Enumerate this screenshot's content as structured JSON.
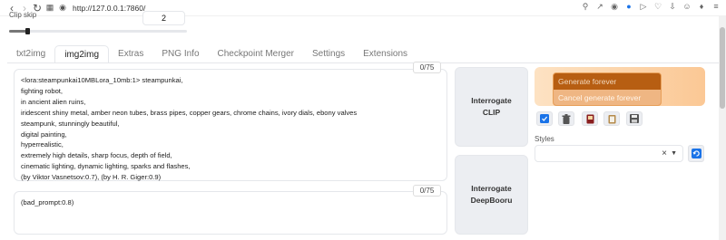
{
  "browser": {
    "url": "http://127.0.0.1:7860/"
  },
  "clip_skip": {
    "label": "Clip skip",
    "value": "2",
    "level": 0.1
  },
  "tabs": [
    {
      "label": "txt2img",
      "active": false
    },
    {
      "label": "img2img",
      "active": true
    },
    {
      "label": "Extras",
      "active": false
    },
    {
      "label": "PNG Info",
      "active": false
    },
    {
      "label": "Checkpoint Merger",
      "active": false
    },
    {
      "label": "Settings",
      "active": false
    },
    {
      "label": "Extensions",
      "active": false
    }
  ],
  "prompt": {
    "counter": "0/75",
    "text": "<lora:steampunkai10MBLora_10mb:1> steampunkai,\nfighting robot,\nin ancient alien ruins,\niridescent shiny metal, amber neon tubes, brass pipes, copper gears, chrome chains, ivory dials, ebony valves\nsteampunk, stunningly beautiful,\ndigital painting,\nhyperrealistic,\nextremely high details, sharp focus, depth of field,\ncinematic lighting, dynamic lighting, sparks and flashes,\n(by Viktor Vasnetsov:0.7), (by H. R. Giger:0.9)"
  },
  "negative_prompt": {
    "counter": "0/75",
    "text": "(bad_prompt:0.8)"
  },
  "interrogate": {
    "clip_label": "Interrogate\nCLIP",
    "deepbooru_label": "Interrogate\nDeepBooru"
  },
  "generate_menu": {
    "items": [
      "Generate forever",
      "Cancel generate forever"
    ]
  },
  "styles": {
    "label": "Styles",
    "clear_symbol": "×",
    "arrow_symbol": "▼"
  },
  "colors": {
    "accent_orange": "#fbc895",
    "menu_dark": "#b75e12",
    "checkbox_blue": "#1a73e8"
  },
  "icons": [
    "back-icon",
    "forward-icon",
    "reload-icon",
    "apps-icon",
    "site-info-icon",
    "search-icon",
    "share-icon",
    "camera-icon",
    "shield-icon",
    "send-icon",
    "heart-icon",
    "download-icon",
    "profile-icon",
    "extensions-icon",
    "menu-icon"
  ]
}
